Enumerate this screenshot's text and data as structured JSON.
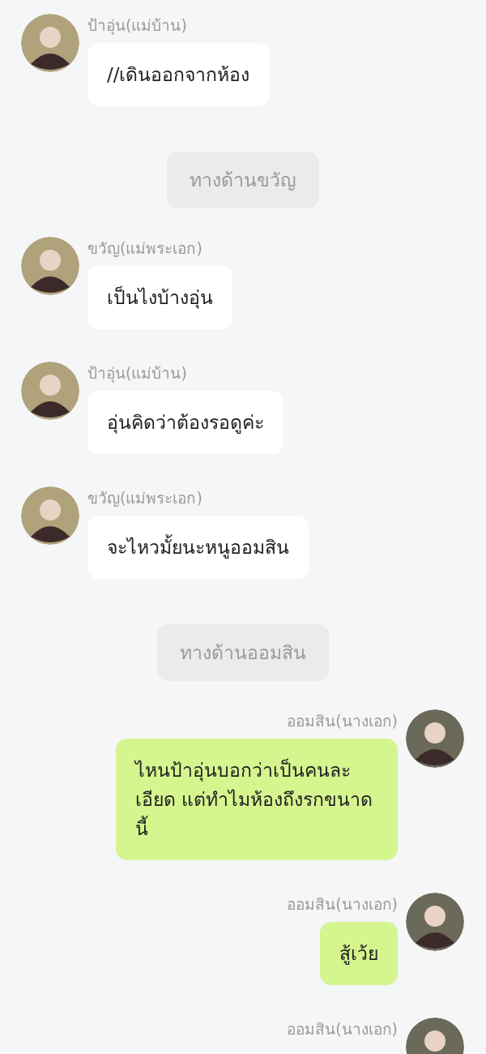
{
  "messages": [
    {
      "kind": "received",
      "name": "ป้าอุ่น(แม่บ้าน)",
      "text": "//เดินออกจากห้อง"
    },
    {
      "kind": "divider",
      "text": "ทางด้านขวัญ"
    },
    {
      "kind": "received",
      "name": "ขวัญ(แม่พระเอก)",
      "text": "เป็นไงบ้างอุ่น"
    },
    {
      "kind": "received",
      "name": "ป้าอุ่น(แม่บ้าน)",
      "text": "อุ่นคิดว่าต้องรอดูค่ะ"
    },
    {
      "kind": "received",
      "name": "ขวัญ(แม่พระเอก)",
      "text": "จะไหวมั้ยนะหนูออมสิน"
    },
    {
      "kind": "divider",
      "text": "ทางด้านออมสิน"
    },
    {
      "kind": "sent",
      "name": "ออมสิน(นางเอก)",
      "text": "ไหนป้าอุ่นบอกว่าเป็นคนละเอียด แต่ทำไมห้องถึงรกขนาดนี้"
    },
    {
      "kind": "sent",
      "name": "ออมสิน(นางเอก)",
      "text": "สู้เว้ย"
    },
    {
      "kind": "sent",
      "name": "ออมสิน(นางเอก)"
    }
  ]
}
